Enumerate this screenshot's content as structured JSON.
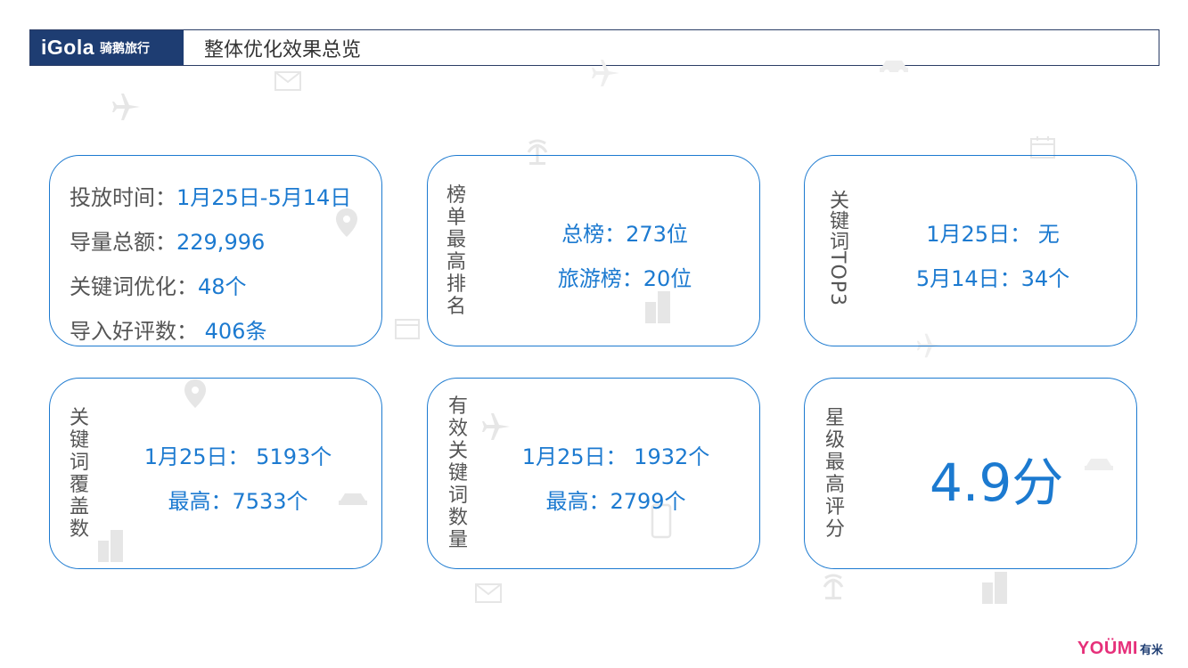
{
  "header": {
    "logo_en": "iGola",
    "logo_cn": "骑鹅旅行",
    "title": "整体优化效果总览"
  },
  "card1": {
    "rows": [
      {
        "label": "投放时间：",
        "value": "1月25日-5月14日"
      },
      {
        "label": "导量总额：",
        "value": "229,996"
      },
      {
        "label": "关键词优化：",
        "value": "48个"
      },
      {
        "label": "导入好评数：",
        "value": " 406条"
      }
    ]
  },
  "card2": {
    "label_chars": [
      "榜",
      "单",
      "最",
      "高",
      "排",
      "名"
    ],
    "rows": [
      {
        "label": "总榜：",
        "value": "273位"
      },
      {
        "label": "旅游榜：",
        "value": "20位"
      }
    ]
  },
  "card3": {
    "label": "关键词TOP3",
    "rows": [
      {
        "label": "1月25日：",
        "value": " 无"
      },
      {
        "label": "5月14日：",
        "value": "34个"
      }
    ]
  },
  "card4": {
    "label_chars": [
      "关",
      "键",
      "词",
      "覆",
      "盖",
      "数"
    ],
    "rows": [
      {
        "label": "1月25日：",
        "value": " 5193个"
      },
      {
        "label": "最高：",
        "value": "7533个"
      }
    ]
  },
  "card5": {
    "label_chars": [
      "有",
      "效",
      "关",
      "键",
      "词",
      "数",
      "量"
    ],
    "rows": [
      {
        "label": "1月25日：",
        "value": " 1932个"
      },
      {
        "label": "最高：",
        "value": "2799个"
      }
    ]
  },
  "card6": {
    "label_chars": [
      "星",
      "级",
      "最",
      "高",
      "评",
      "分"
    ],
    "score": "4.9分"
  },
  "footer": {
    "logo_en": "YOÜMI",
    "logo_cn": "有米"
  },
  "colors": {
    "accent": "#1c7ad0",
    "header_bg": "#1e3d72",
    "border": "#2b3d66",
    "footer_brand": "#e6307a"
  },
  "icons": [
    "plane-icon",
    "mail-icon",
    "car-icon",
    "palm-tree-icon",
    "calendar-icon",
    "map-pin-icon",
    "building-icon",
    "phone-icon"
  ]
}
